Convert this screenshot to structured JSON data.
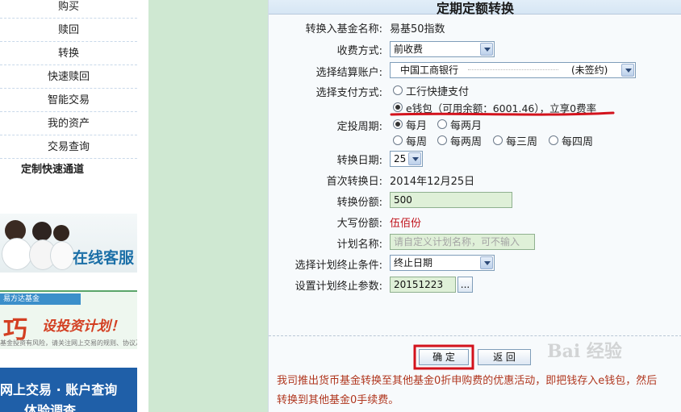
{
  "sidebar": {
    "items": [
      {
        "label": "购买"
      },
      {
        "label": "赎回"
      },
      {
        "label": "转换"
      },
      {
        "label": "快速赎回"
      },
      {
        "label": "智能交易"
      },
      {
        "label": "我的资产"
      },
      {
        "label": "交易查询"
      },
      {
        "label": "定制快速通道"
      }
    ],
    "banners": {
      "service": "在线客服",
      "plan_brand": "易方达基金",
      "plan_big": "巧",
      "plan_slogan": "设投资计划！",
      "plan_small": "基金投资有风险，请关注网上交易的规则、协议及风险",
      "trade_line1": "网上交易 · 账户查询",
      "trade_line2": "体验调查"
    }
  },
  "form": {
    "title": "定期定额转换",
    "fund_label": "转换入基金名称:",
    "fund_value": "易基50指数",
    "fee_label": "收费方式:",
    "fee_value": "前收费",
    "account_label": "选择结算账户:",
    "account_value": "中国工商银行",
    "account_status": "(未签约)",
    "pay_label": "选择支付方式:",
    "pay_options": [
      "工行快捷支付",
      "e钱包（可用余额：6001.46），立享0费率"
    ],
    "pay_selected": 1,
    "cycle_label": "定投周期:",
    "cycle_options": [
      "每月",
      "每两月",
      "每周",
      "每两周",
      "每三周",
      "每四周"
    ],
    "cycle_selected": 0,
    "date_label": "转换日期:",
    "date_value": "25",
    "first_label": "首次转换日:",
    "first_value": "2014年12月25日",
    "shares_label": "转换份额:",
    "shares_value": "500",
    "capital_label": "大写份额:",
    "capital_value": "伍佰份",
    "plan_label": "计划名称:",
    "plan_placeholder": "请自定义计划名称，可不输入",
    "end_cond_label": "选择计划终止条件:",
    "end_cond_value": "终止日期",
    "end_param_label": "设置计划终止参数:",
    "end_param_value": "20151223",
    "ellipsis_button": "...",
    "confirm_button": "确 定",
    "back_button": "返 回",
    "note": "我司推出货币基金转换至其他基金0折申购费的优惠活动，即把钱存入e钱包，然后转换到其他基金0手续费。"
  },
  "watermark": "Bai 经验",
  "colors": {
    "accent_red": "#c0121a",
    "green_panel": "#cfe8d2",
    "input_green": "#dff0d8"
  }
}
